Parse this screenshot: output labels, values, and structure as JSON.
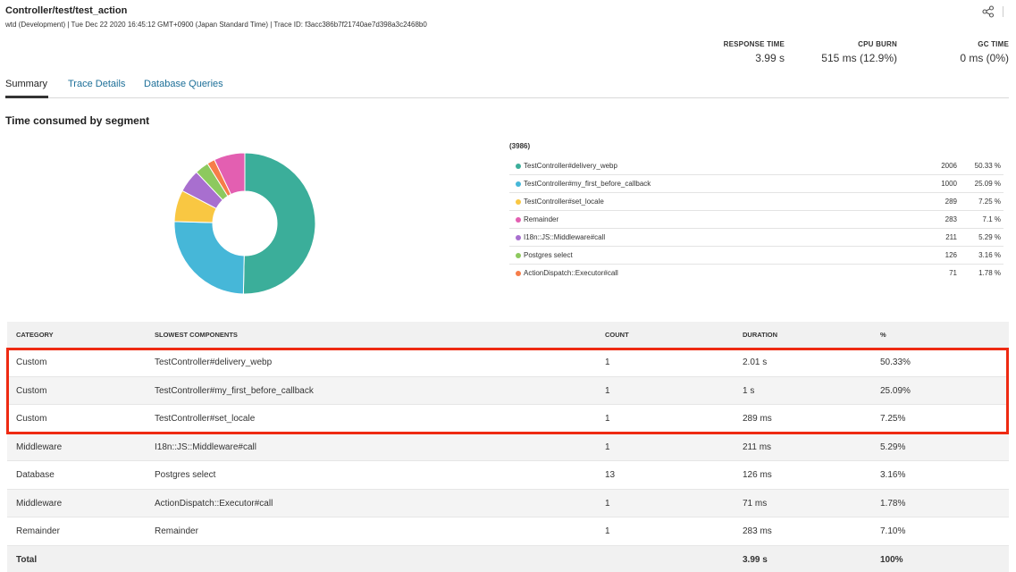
{
  "header": {
    "title": "Controller/test/test_action",
    "subtitle": "wtd (Development) | Tue Dec 22 2020 16:45:12 GMT+0900 (Japan Standard Time) | Trace ID: f3acc386b7f21740ae7d398a3c2468b0"
  },
  "metrics": [
    {
      "label": "RESPONSE TIME",
      "value": "3.99 s"
    },
    {
      "label": "CPU BURN",
      "value": "515 ms (12.9%)"
    },
    {
      "label": "GC TIME",
      "value": "0 ms (0%)"
    }
  ],
  "tabs": [
    {
      "label": "Summary",
      "active": true
    },
    {
      "label": "Trace Details",
      "active": false
    },
    {
      "label": "Database Queries",
      "active": false
    }
  ],
  "section": {
    "title": "Time consumed by segment"
  },
  "chart_data": {
    "type": "pie",
    "total_label": "(3986)",
    "slices": [
      {
        "label": "TestController#delivery_webp",
        "count": "2006",
        "percent": "50.33 %",
        "value": 50.33,
        "color": "#3bae9a"
      },
      {
        "label": "TestController#my_first_before_callback",
        "count": "1000",
        "percent": "25.09 %",
        "value": 25.09,
        "color": "#46b7d8"
      },
      {
        "label": "TestController#set_locale",
        "count": "289",
        "percent": "7.25 %",
        "value": 7.25,
        "color": "#f9c742"
      },
      {
        "label": "Remainder",
        "count": "283",
        "percent": "7.1 %",
        "value": 7.1,
        "color": "#e35fb1"
      },
      {
        "label": "I18n::JS::Middleware#call",
        "count": "211",
        "percent": "5.29 %",
        "value": 5.29,
        "color": "#a86fcf"
      },
      {
        "label": "Postgres select",
        "count": "126",
        "percent": "3.16 %",
        "value": 3.16,
        "color": "#8dc95e"
      },
      {
        "label": "ActionDispatch::Executor#call",
        "count": "71",
        "percent": "1.78 %",
        "value": 1.78,
        "color": "#f67d49"
      }
    ],
    "draw_order": [
      0,
      1,
      2,
      4,
      5,
      6,
      3
    ]
  },
  "table": {
    "headers": {
      "category": "CATEGORY",
      "components": "SLOWEST COMPONENTS",
      "count": "COUNT",
      "duration": "DURATION",
      "percent": "%"
    },
    "rows": [
      {
        "category": "Custom",
        "component": "TestController#delivery_webp",
        "count": "1",
        "duration": "2.01 s",
        "percent": "50.33%"
      },
      {
        "category": "Custom",
        "component": "TestController#my_first_before_callback",
        "count": "1",
        "duration": "1 s",
        "percent": "25.09%"
      },
      {
        "category": "Custom",
        "component": "TestController#set_locale",
        "count": "1",
        "duration": "289 ms",
        "percent": "7.25%"
      },
      {
        "category": "Middleware",
        "component": "I18n::JS::Middleware#call",
        "count": "1",
        "duration": "211 ms",
        "percent": "5.29%"
      },
      {
        "category": "Database",
        "component": "Postgres select",
        "count": "13",
        "duration": "126 ms",
        "percent": "3.16%"
      },
      {
        "category": "Middleware",
        "component": "ActionDispatch::Executor#call",
        "count": "1",
        "duration": "71 ms",
        "percent": "1.78%"
      },
      {
        "category": "Remainder",
        "component": "Remainder",
        "count": "1",
        "duration": "283 ms",
        "percent": "7.10%"
      }
    ],
    "total": {
      "label": "Total",
      "duration": "3.99 s",
      "percent": "100%"
    }
  }
}
